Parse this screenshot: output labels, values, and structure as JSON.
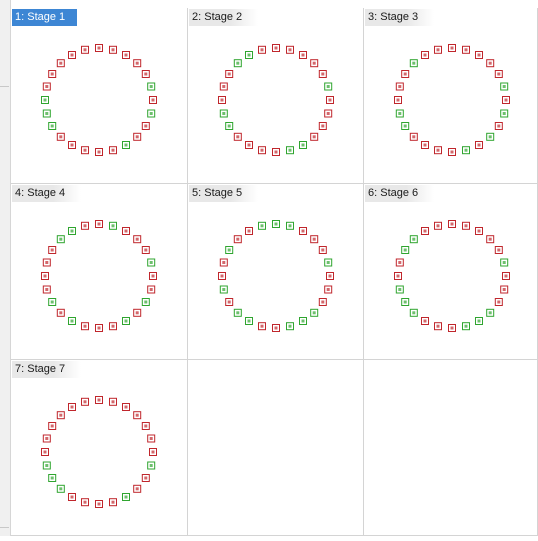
{
  "stages": [
    {
      "label": "1: Stage 1",
      "selected": true,
      "markers": [
        "red",
        "red",
        "red",
        "red",
        "red",
        "green",
        "red",
        "green",
        "red",
        "red",
        "green",
        "red",
        "red",
        "red",
        "red",
        "red",
        "green",
        "green",
        "green",
        "red",
        "red",
        "red",
        "red",
        "red"
      ]
    },
    {
      "label": "2: Stage 2",
      "selected": false,
      "markers": [
        "red",
        "red",
        "red",
        "red",
        "red",
        "green",
        "red",
        "red",
        "red",
        "red",
        "green",
        "green",
        "red",
        "red",
        "red",
        "red",
        "green",
        "green",
        "red",
        "red",
        "red",
        "green",
        "green",
        "red"
      ]
    },
    {
      "label": "3: Stage 3",
      "selected": false,
      "markers": [
        "red",
        "red",
        "red",
        "red",
        "red",
        "green",
        "red",
        "green",
        "red",
        "green",
        "red",
        "green",
        "red",
        "red",
        "red",
        "red",
        "green",
        "green",
        "red",
        "red",
        "red",
        "green",
        "red",
        "red"
      ]
    },
    {
      "label": "4: Stage 4",
      "selected": false,
      "markers": [
        "red",
        "green",
        "red",
        "red",
        "red",
        "green",
        "red",
        "red",
        "green",
        "red",
        "green",
        "red",
        "red",
        "red",
        "green",
        "red",
        "green",
        "red",
        "red",
        "red",
        "red",
        "green",
        "green",
        "red"
      ]
    },
    {
      "label": "5: Stage 5",
      "selected": false,
      "markers": [
        "green",
        "green",
        "red",
        "red",
        "red",
        "green",
        "red",
        "red",
        "red",
        "green",
        "green",
        "green",
        "red",
        "red",
        "green",
        "green",
        "red",
        "green",
        "red",
        "red",
        "green",
        "red",
        "red",
        "green"
      ]
    },
    {
      "label": "6: Stage 6",
      "selected": false,
      "markers": [
        "red",
        "red",
        "red",
        "red",
        "red",
        "green",
        "red",
        "red",
        "red",
        "green",
        "green",
        "green",
        "red",
        "red",
        "red",
        "green",
        "green",
        "green",
        "red",
        "red",
        "green",
        "green",
        "red",
        "red"
      ]
    },
    {
      "label": "7: Stage 7",
      "selected": false,
      "markers": [
        "red",
        "red",
        "red",
        "red",
        "red",
        "red",
        "red",
        "green",
        "red",
        "red",
        "green",
        "red",
        "red",
        "red",
        "red",
        "green",
        "green",
        "green",
        "red",
        "red",
        "red",
        "red",
        "red",
        "red"
      ]
    }
  ],
  "colors": {
    "red": "#c0262c",
    "green": "#2fa52f",
    "selected_bg": "#3d86d4"
  }
}
